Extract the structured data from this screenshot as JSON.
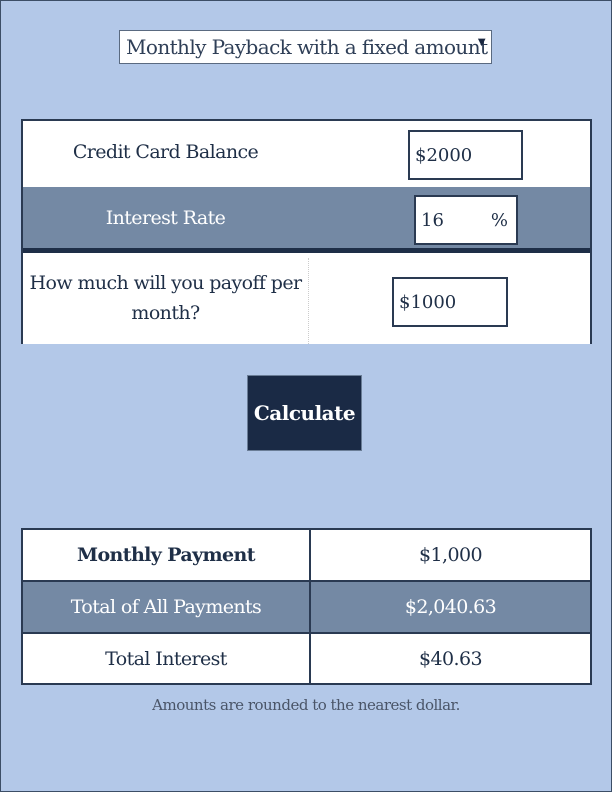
{
  "mode_select": {
    "selected": "Monthly Payback with a fixed amount",
    "arrow_icon": "triangle-down"
  },
  "inputs": {
    "balance": {
      "label": "Credit Card Balance",
      "value": "$2000"
    },
    "interest": {
      "label": "Interest Rate",
      "value": "16",
      "unit": "%"
    },
    "payoff": {
      "label": "How much will you payoff per month?",
      "value": "$1000"
    }
  },
  "calculate_label": "Calculate",
  "results": [
    {
      "label": "Monthly Payment",
      "value": "$1,000"
    },
    {
      "label": "Total of All Payments",
      "value": "$2,040.63"
    },
    {
      "label": "Total Interest",
      "value": "$40.63"
    }
  ],
  "note": "Amounts are rounded to the nearest dollar.",
  "colors": {
    "background": "#b3c8e8",
    "dark": "#1a2a45",
    "band": "#7489a4"
  }
}
